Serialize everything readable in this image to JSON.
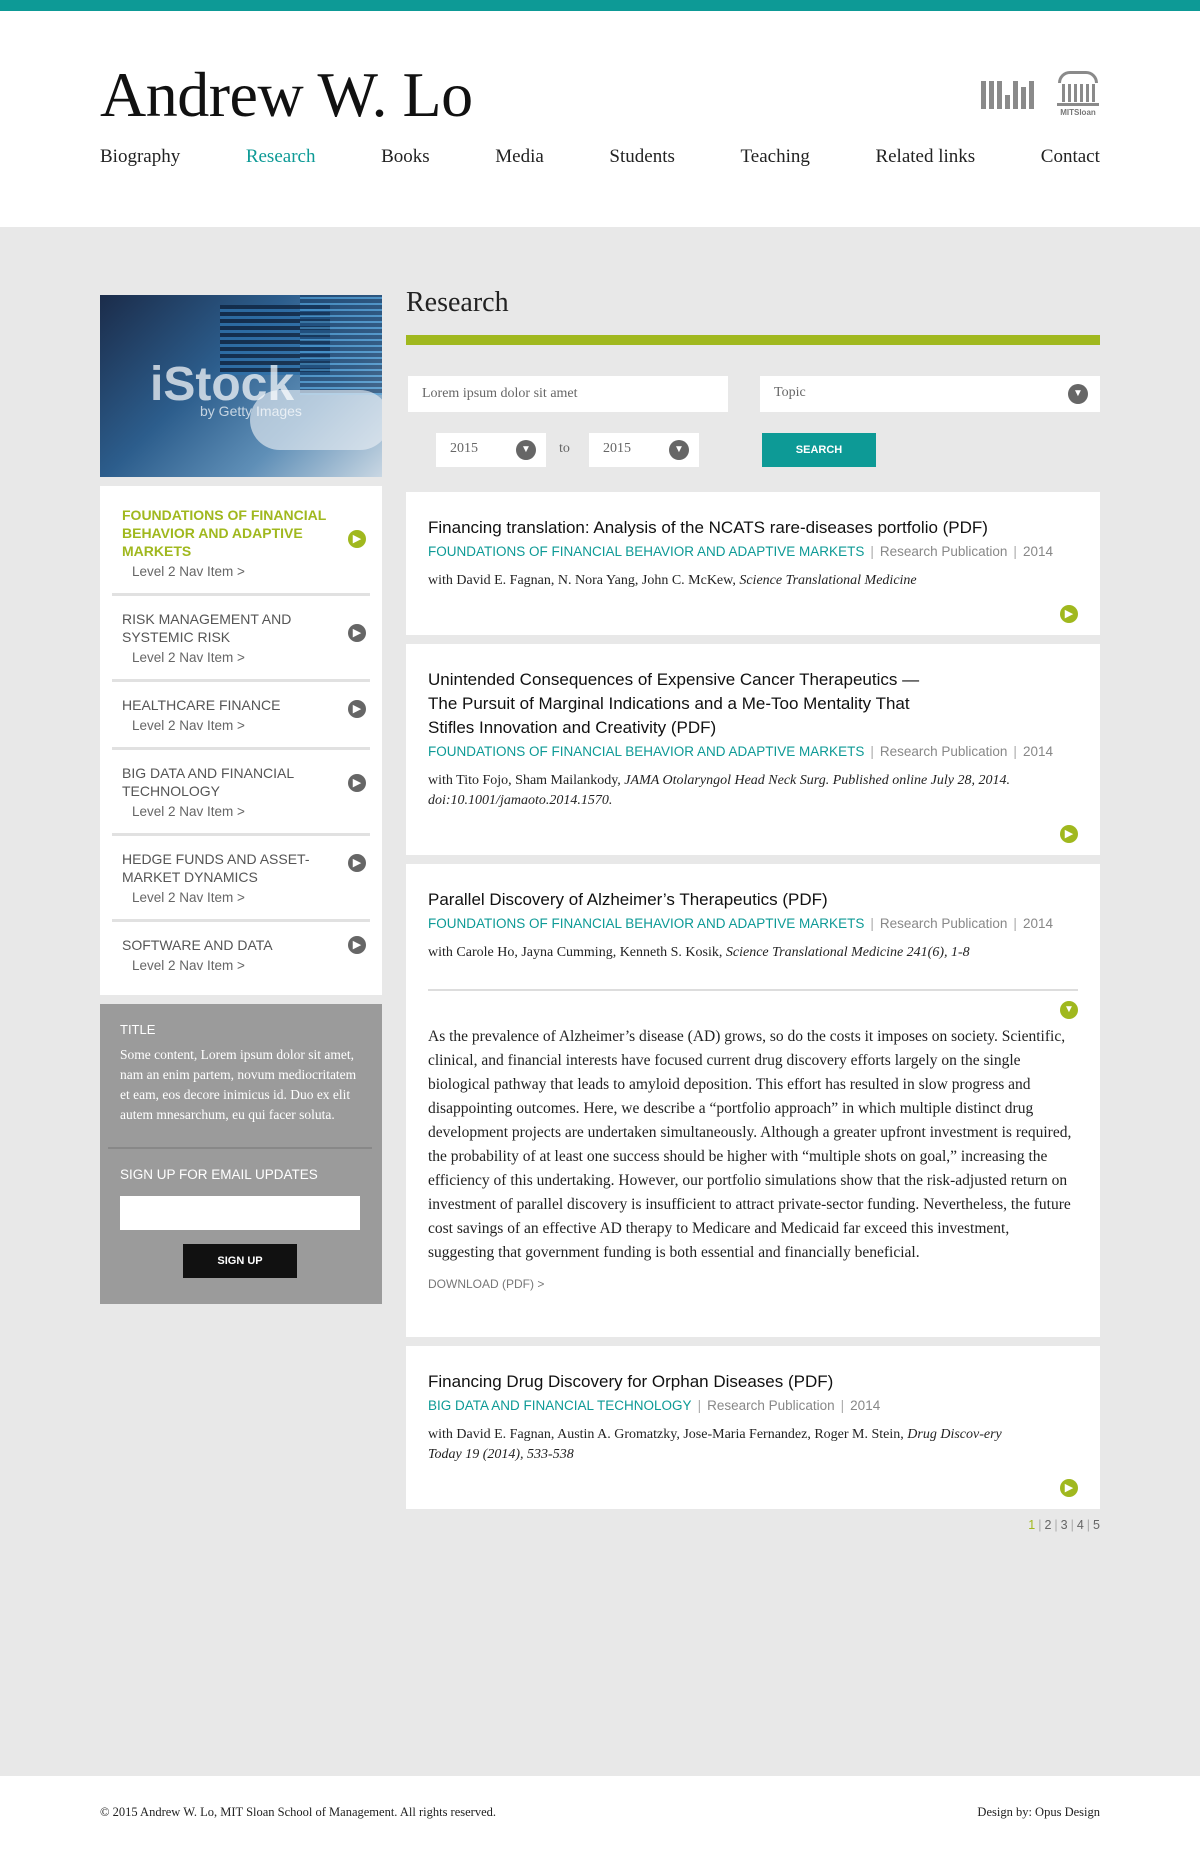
{
  "site": {
    "title": "Andrew W. Lo",
    "logo_mit": "MIT",
    "logo_sloan": "MITSloan"
  },
  "nav": {
    "items": [
      "Biography",
      "Research",
      "Books",
      "Media",
      "Students",
      "Teaching",
      "Related links",
      "Contact"
    ],
    "active": "Research"
  },
  "sidebar": {
    "image_watermark": "iStock",
    "image_watermark_sub": "by Getty Images",
    "items": [
      {
        "title": "FOUNDATIONS OF FINANCIAL BEHAVIOR AND ADAPTIVE MARKETS",
        "sub": "Level 2 Nav Item >",
        "active": true
      },
      {
        "title": "RISK MANAGEMENT AND SYSTEMIC RISK",
        "sub": "Level 2 Nav Item >"
      },
      {
        "title": "HEALTHCARE FINANCE",
        "sub": "Level 2 Nav Item >"
      },
      {
        "title": "BIG DATA AND FINANCIAL TECHNOLOGY",
        "sub": "Level 2 Nav Item >"
      },
      {
        "title": "HEDGE FUNDS AND ASSET-MARKET DYNAMICS",
        "sub": "Level 2 Nav Item >"
      },
      {
        "title": "SOFTWARE AND DATA",
        "sub": "Level 2 Nav Item >"
      }
    ],
    "box": {
      "title": "TITLE",
      "text": "Some content, Lorem ipsum dolor sit amet, nam an enim partem, novum mediocritatem et eam, eos decore inimicus id. Duo ex elit autem mnesarchum, eu qui facer soluta.",
      "signup_title": "SIGN UP FOR EMAIL UPDATES",
      "email_value": "",
      "signup_label": "SIGN UP"
    }
  },
  "main": {
    "heading": "Research",
    "search": {
      "keyword_value": "Lorem ipsum dolor sit amet",
      "topic_value": "Topic",
      "year_from": "2015",
      "to_label": "to",
      "year_to": "2015",
      "button_label": "SEARCH"
    },
    "results": [
      {
        "title": "Financing translation: Analysis of the NCATS rare-diseases portfolio (PDF)",
        "topic": "FOUNDATIONS OF FINANCIAL BEHAVIOR AND ADAPTIVE MARKETS",
        "type": "Research Publication",
        "year": "2014",
        "authors": "with David E. Fagnan, N. Nora Yang, John C. McKew, ",
        "journal": "Science Translational Medicine"
      },
      {
        "title": "Unintended Consequences of Expensive Cancer Therapeutics — The Pursuit of Marginal Indications and a Me-Too Mentality That Stifles Innovation and Creativity (PDF)",
        "topic": "FOUNDATIONS OF FINANCIAL BEHAVIOR AND ADAPTIVE MARKETS",
        "type": "Research Publication",
        "year": "2014",
        "authors": "with Tito Fojo, Sham Mailankody, ",
        "journal": "JAMA Otolaryngol Head Neck Surg. Published online July 28, 2014. doi:10.1001/jamaoto.2014.1570."
      },
      {
        "title": "Parallel Discovery of Alzheimer’s Therapeutics (PDF)",
        "topic": "FOUNDATIONS OF FINANCIAL BEHAVIOR AND ADAPTIVE MARKETS",
        "type": "Research Publication",
        "year": "2014",
        "authors": "with Carole Ho, Jayna Cumming, Kenneth S. Kosik, ",
        "journal": "Science Translational Medicine 241(6), 1-8",
        "abstract": "As the prevalence of Alzheimer’s disease (AD) grows, so do the costs it imposes on society. Scientific, clinical, and financial interests have focused current drug discovery efforts largely on the single biological pathway that leads to amyloid deposition. This effort has resulted in slow progress and disappointing outcomes. Here, we describe a “portfolio approach” in which multiple distinct drug development projects are undertaken simultaneously. Although a greater upfront investment is required, the probability of at least one success should be higher with “multiple shots on goal,” increasing the efficiency of this undertaking. However, our portfolio simulations show that the risk-adjusted return on investment of parallel discovery is insufficient to attract private-sector funding. Nevertheless, the future cost savings of an effective AD therapy to Medicare and Medicaid far exceed this investment, suggesting that government funding is both essential and financially beneficial.",
        "download": "DOWNLOAD (PDF) >"
      },
      {
        "title": "Financing Drug Discovery for Orphan Diseases (PDF)",
        "topic": "BIG DATA AND FINANCIAL TECHNOLOGY",
        "type": "Research Publication",
        "year": "2014",
        "authors": "with David E. Fagnan, Austin A. Gromatzky, Jose-Maria Fernandez, Roger M. Stein, ",
        "journal": "Drug Discov-ery Today 19 (2014), 533-538"
      }
    ],
    "pager": {
      "pages": [
        "1",
        "2",
        "3",
        "4",
        "5"
      ],
      "current": "1"
    }
  },
  "footer": {
    "copyright": "© 2015 Andrew W. Lo, MIT Sloan School of Management. All rights reserved.",
    "design": "Design by: Opus Design"
  },
  "colors": {
    "accent": "#0d9a96",
    "highlight": "#a0b81e",
    "background": "#e8e8e8"
  }
}
